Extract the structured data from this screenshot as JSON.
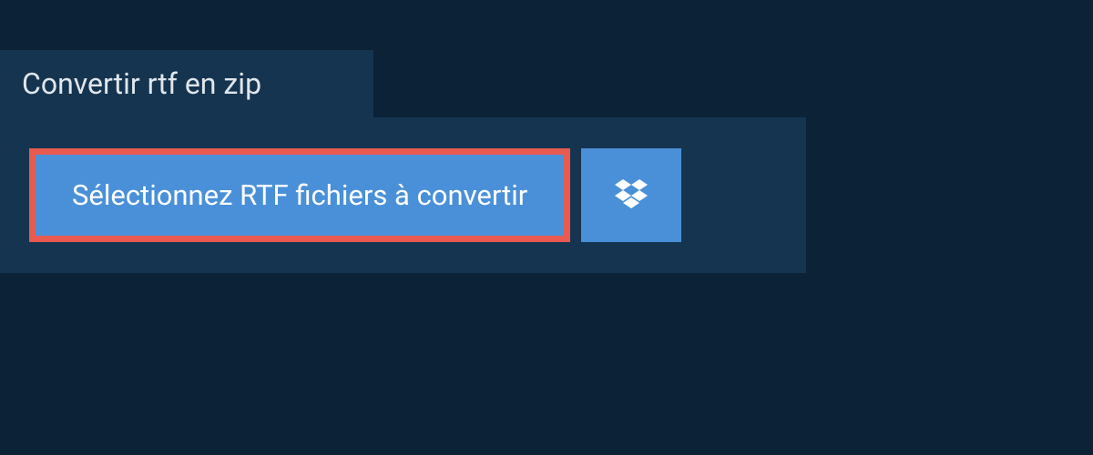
{
  "tab": {
    "title": "Convertir rtf en zip"
  },
  "panel": {
    "select_button_label": "Sélectionnez RTF fichiers à convertir"
  }
}
